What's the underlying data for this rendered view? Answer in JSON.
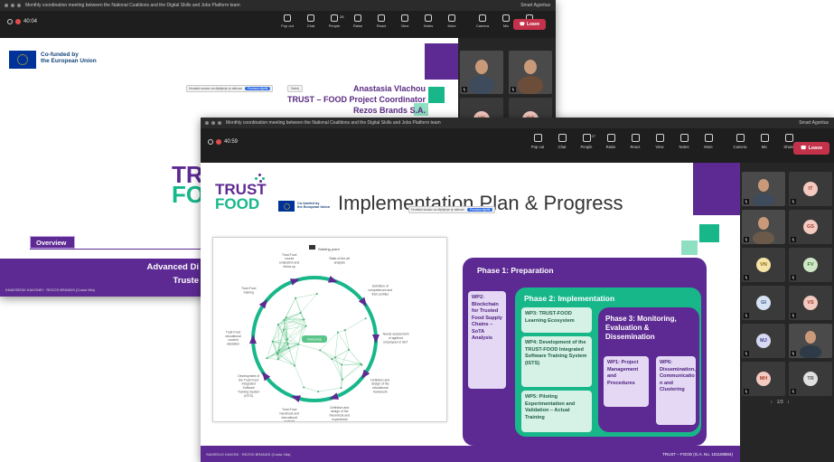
{
  "back_window": {
    "title": "Monthly coordination meeting between the National Coalitions and the Digital Skills and Jobs Platform team",
    "account": "Smart Agoritus",
    "timer": "40:04",
    "toolbar": [
      {
        "label": "Pop out",
        "icon": "pop-out-icon"
      },
      {
        "label": "Chat",
        "icon": "chat-icon"
      },
      {
        "label": "People",
        "icon": "people-icon",
        "count": "28"
      },
      {
        "label": "Raise",
        "icon": "hand-icon"
      },
      {
        "label": "React",
        "icon": "react-icon"
      },
      {
        "label": "View",
        "icon": "view-icon"
      },
      {
        "label": "Notes",
        "icon": "notes-icon"
      },
      {
        "label": "More",
        "icon": "more-icon"
      },
      {
        "label": "Camera",
        "icon": "camera-icon"
      },
      {
        "label": "Mic",
        "icon": "mic-icon"
      },
      {
        "label": "Share",
        "icon": "share-icon"
      }
    ],
    "leave_label": "Leave",
    "slide": {
      "eu_label_line1": "Co-funded by",
      "eu_label_line2": "the European Union",
      "share_notice": "Hrvatski sustav za dijeljenje je aktivan",
      "share_stop": "Prestani dijeliti",
      "share_hide": "Sakrij",
      "presenter_name": "Anastasia Vlachou",
      "presenter_role": "TRUST – FOOD Project Coordinator",
      "presenter_org": "Rezos Brands S.A.",
      "logo_line1": "TR",
      "logo_line2": "FO",
      "overview_label": "Overview",
      "footer_line1": "Advanced Di",
      "footer_line2": "Truste",
      "footer_id": "KNAESEDIK KAKONEI · REZOS BRANDS (Costa Vita)"
    },
    "participants": [
      {
        "type": "video",
        "name": ""
      },
      {
        "type": "video",
        "name": ""
      },
      {
        "initials": "VS",
        "bg": "#f3c9c0",
        "fg": "#a63f2c"
      },
      {
        "initials": "GS",
        "bg": "#f3c9c0",
        "fg": "#a63f2c"
      }
    ]
  },
  "front_window": {
    "title": "Monthly coordination meeting between the National Coalitions and the Digital Skills and Jobs Platform team",
    "account": "Smart Agoritus",
    "timer": "40:59",
    "toolbar": [
      {
        "label": "Pop out",
        "icon": "pop-out-icon"
      },
      {
        "label": "Chat",
        "icon": "chat-icon"
      },
      {
        "label": "People",
        "icon": "people-icon",
        "count": "27"
      },
      {
        "label": "Raise",
        "icon": "hand-icon"
      },
      {
        "label": "React",
        "icon": "react-icon"
      },
      {
        "label": "View",
        "icon": "view-icon"
      },
      {
        "label": "Notes",
        "icon": "notes-icon"
      },
      {
        "label": "More",
        "icon": "more-icon"
      },
      {
        "label": "Camera",
        "icon": "camera-icon"
      },
      {
        "label": "Mic",
        "icon": "mic-icon"
      },
      {
        "label": "Share",
        "icon": "share-icon"
      }
    ],
    "leave_label": "Leave",
    "slide": {
      "logo_line1": "TRUST",
      "logo_line2": "FOOD",
      "eu_label_line1": "Co-funded by",
      "eu_label_line2": "the European Union",
      "title_before": "Implementation",
      "title_after": "Plan & Progress",
      "share_notice": "Hrvatski sustav za dijeljenje je aktivan",
      "share_stop": "Prestani dijeliti",
      "diagram": {
        "start": "Starting point",
        "center": "Outcome",
        "nodes": [
          "State-of-the-art analysis",
          "Definition of competences and their profiles",
          "Needs assessment of agrifood employees in SET",
          "Definition and design of the educational framework",
          "Definition and design of the theoretical and experiential approaches",
          "Trust-Food handbook and educational material",
          "Development of the Trust-Food Integrated Software Training System (ISTS)",
          "Trust-Food educational content validation",
          "Trust-Food training",
          "Trust-Food course evaluation and follow up"
        ]
      },
      "phase1": {
        "title": "Phase 1: Preparation",
        "wp2": "WP2: Blockchain for Trusted Food Supply Chains – SoTA Analysis"
      },
      "phase2": {
        "title": "Phase 2: Implementation",
        "wp3": "WP3: TRUST-FOOD Learning Ecosystem",
        "wp4": "WP4: Development of the TRUST-FOOD Integrated Software Training System (ISTS)",
        "wp5": "WP5: Piloting Experimentation and Validation – Actual Training"
      },
      "phase3": {
        "title_line1": "Phase 3: Monitoring,",
        "title_line2": "Evaluation &",
        "title_line3": "Dissemination",
        "wp1": "WP1: Project Management and Procedures",
        "wp6": "WP6: Dissemination, Communicatio n and Clustering"
      },
      "footer_left": "SAMSELIK KAKONI · REZOS BRANDS (Costa Vita)",
      "footer_right": "TRUST – FOOD (G.A. No. 101100804)"
    },
    "participants": [
      {
        "type": "video",
        "initials": ""
      },
      {
        "initials": "IT",
        "bg": "#f3c9c0",
        "fg": "#a63f2c"
      },
      {
        "type": "video",
        "initials": ""
      },
      {
        "initials": "GS",
        "bg": "#f3c9c0",
        "fg": "#a63f2c"
      },
      {
        "initials": "VN",
        "bg": "#f5e3a8",
        "fg": "#8a6a10"
      },
      {
        "initials": "FV",
        "bg": "#cfe8c8",
        "fg": "#3f7a33"
      },
      {
        "initials": "GI",
        "bg": "#d7e2f3",
        "fg": "#3a5a8c"
      },
      {
        "initials": "VS",
        "bg": "#f3c9c0",
        "fg": "#a63f2c"
      },
      {
        "initials": "MJ",
        "bg": "#d7d9f3",
        "fg": "#3b3f8c"
      },
      {
        "type": "video",
        "initials": ""
      },
      {
        "initials": "MH",
        "bg": "#f3c9c0",
        "fg": "#a63f2c"
      },
      {
        "initials": "TR",
        "bg": "#e0e0e0",
        "fg": "#555555"
      }
    ],
    "pager": "1/3"
  },
  "colors": {
    "purple": "#5d2a93",
    "teal": "#17b78a",
    "light_teal": "#8fe0c3",
    "leave_red": "#c4314b"
  }
}
